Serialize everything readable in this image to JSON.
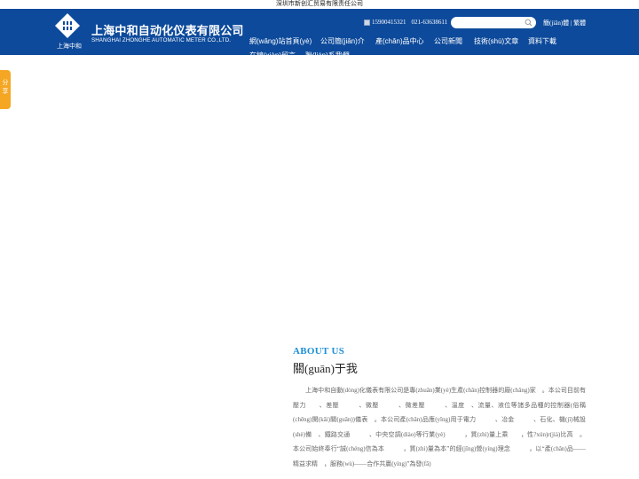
{
  "topbar": {
    "text": "深圳市新创汇贸易有限责任公司"
  },
  "header": {
    "logo_caption": "上海中和",
    "company_cn": "上海中和自动化仪表有限公司",
    "company_en": "SHANGHAI ZHONGHE AUTOMATIC METER CO.,LTD.",
    "phone1": "15900415321",
    "phone2": "021-63638611",
    "search": {
      "value": "",
      "placeholder": ""
    },
    "lang_simplified": "簡(jiǎn)體",
    "lang_sep": " | ",
    "lang_traditional": "繁體"
  },
  "nav": {
    "items": [
      "網(wǎng)站首頁(yè)",
      "公司簡(jiǎn)介",
      "產(chǎn)品中心",
      "公司新聞",
      "技術(shù)文章",
      "資料下載",
      "在線(xiàn)留言",
      "聯(lián)系我們"
    ]
  },
  "share": {
    "label": "分享"
  },
  "about": {
    "title_en": "ABOUT US",
    "title_cn": "關(guān)于我",
    "body": "　　上海中和自動(dòng)化儀表有限公司是專(zhuān)業(yè)生產(chǎn)控制器的廠(chǎng)家　。本公司目前有壓力　　、差壓　　　、微壓　　　、微差壓　　　、溫度　、流量、液位等諸多品種的控制器(俗稱(chēng)開(kāi)關(guān))儀表　。本公司產(chǎn)品應(yīng)用于電力　　　、冶金　　　、石化、機(jī)械設(shè)備　、鐵路交通　　　、中央空調(diào)等行業(yè)　　　，質(zhì)量上乘　　，性?xún)r(jià)比高　。本公司始終奉行“誠(chéng)信為本　　　，質(zhì)量為本”的經(jīng)營(yíng)理念　　　，以“產(chǎn)品——精益求精　，服務(wù)——合作共贏(yíng)”為發(fā)"
  },
  "colors": {
    "header_bg": "#0d4a9b",
    "accent": "#1b8fd6",
    "share_bg": "#f5a623"
  }
}
